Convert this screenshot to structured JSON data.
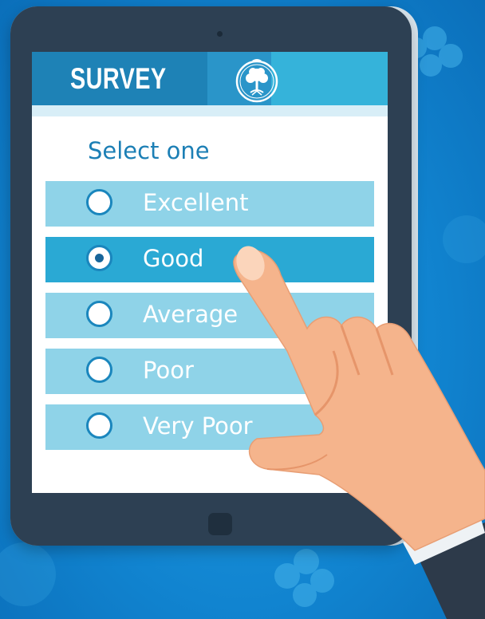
{
  "header": {
    "title": "SURVEY",
    "logo_icon": "tree-icon"
  },
  "survey": {
    "prompt": "Select one",
    "options": [
      {
        "label": "Excellent",
        "selected": false
      },
      {
        "label": "Good",
        "selected": true
      },
      {
        "label": "Average",
        "selected": false
      },
      {
        "label": "Poor",
        "selected": false
      },
      {
        "label": "Very Poor",
        "selected": false
      }
    ]
  },
  "colors": {
    "background": "#1184d0",
    "header_dark": "#1e82b6",
    "option_bg": "#8fd3e8",
    "option_selected_bg": "#2aa9d4",
    "tablet_frame": "#2d4053"
  }
}
